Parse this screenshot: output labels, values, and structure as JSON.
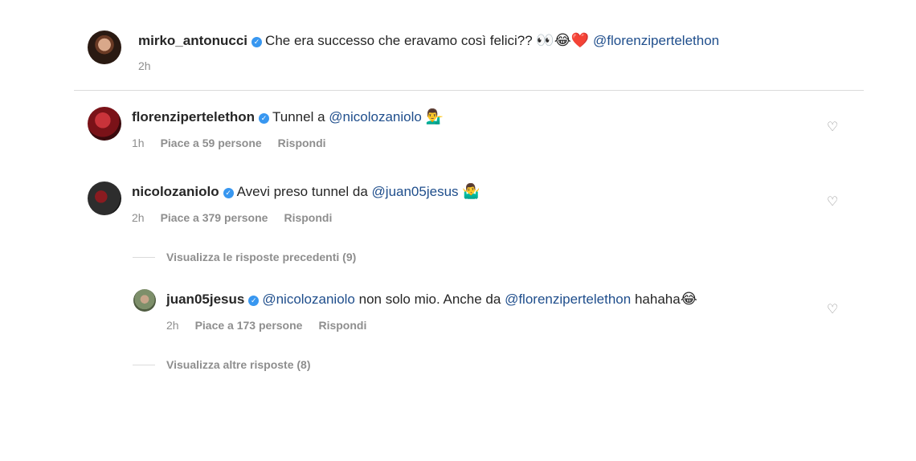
{
  "post": {
    "username": "mirko_antonucci",
    "text": "Che era successo che eravamo così felici??",
    "emojis": "👀😂❤️",
    "mention": "@florenzipertelethon",
    "time": "2h"
  },
  "comments": [
    {
      "username": "florenzipertelethon",
      "text_before": "Tunnel a",
      "mention": "@nicolozaniolo",
      "emoji": "💁‍♂️",
      "time": "1h",
      "likes": "Piace a 59 persone",
      "reply": "Rispondi"
    },
    {
      "username": "nicolozaniolo",
      "text_before": "Avevi preso tunnel da",
      "mention": "@juan05jesus",
      "emoji": "🤷‍♂️",
      "time": "2h",
      "likes": "Piace a 379 persone",
      "reply": "Rispondi"
    }
  ],
  "view_previous": "Visualizza le risposte precedenti (9)",
  "reply": {
    "username": "juan05jesus",
    "mention1": "@nicolozaniolo",
    "text_mid": "non solo mio. Anche da",
    "mention2": "@florenzipertelethon",
    "text_after": "hahaha",
    "emoji": "😂",
    "time": "2h",
    "likes": "Piace a 173 persone",
    "reply": "Rispondi"
  },
  "view_more": "Visualizza altre risposte (8)",
  "icons": {
    "verified": "verified-badge-icon",
    "like": "heart-outline-icon"
  }
}
